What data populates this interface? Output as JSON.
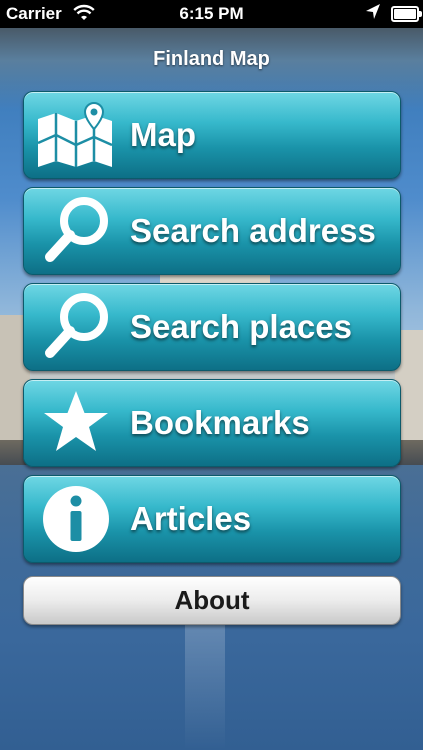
{
  "status_bar": {
    "carrier": "Carrier",
    "time": "6:15 PM"
  },
  "header": {
    "title": "Finland Map"
  },
  "menu": {
    "items": [
      {
        "label": "Map",
        "icon": "map-icon"
      },
      {
        "label": "Search address",
        "icon": "magnifier-icon"
      },
      {
        "label": "Search places",
        "icon": "magnifier-icon"
      },
      {
        "label": "Bookmarks",
        "icon": "star-icon"
      },
      {
        "label": "Articles",
        "icon": "info-icon"
      }
    ],
    "about_label": "About"
  },
  "colors": {
    "button_top": "#6fd7e4",
    "button_bottom": "#0d6f86",
    "status_bar": "#000000"
  }
}
